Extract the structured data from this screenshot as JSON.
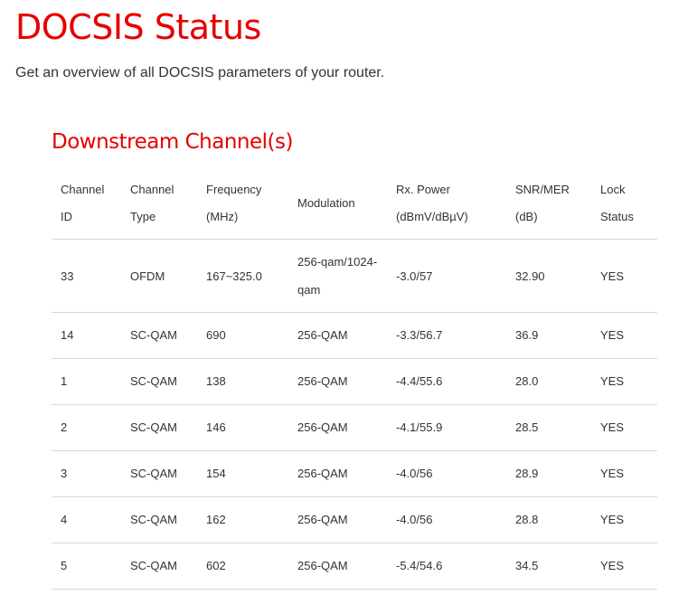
{
  "page": {
    "title": "DOCSIS Status",
    "subtitle": "Get an overview of all DOCSIS parameters of your router."
  },
  "downstream": {
    "title": "Downstream Channel(s)",
    "columns": [
      {
        "line1": "Channel",
        "line2": "ID"
      },
      {
        "line1": "Channel",
        "line2": "Type"
      },
      {
        "line1": "Frequency",
        "line2": "(MHz)"
      },
      {
        "line1": "Modulation",
        "line2": ""
      },
      {
        "line1": "Rx. Power",
        "line2": "(dBmV/dBµV)"
      },
      {
        "line1": "SNR/MER",
        "line2": "(dB)"
      },
      {
        "line1": "Lock",
        "line2": "Status"
      }
    ],
    "rows": [
      {
        "channel_id": "33",
        "channel_type": "OFDM",
        "frequency": "167~325.0",
        "modulation": "256-qam/1024-qam",
        "rx_power": "-3.0/57",
        "snr_mer": "32.90",
        "lock_status": "YES"
      },
      {
        "channel_id": "14",
        "channel_type": "SC-QAM",
        "frequency": "690",
        "modulation": "256-QAM",
        "rx_power": "-3.3/56.7",
        "snr_mer": "36.9",
        "lock_status": "YES"
      },
      {
        "channel_id": "1",
        "channel_type": "SC-QAM",
        "frequency": "138",
        "modulation": "256-QAM",
        "rx_power": "-4.4/55.6",
        "snr_mer": "28.0",
        "lock_status": "YES"
      },
      {
        "channel_id": "2",
        "channel_type": "SC-QAM",
        "frequency": "146",
        "modulation": "256-QAM",
        "rx_power": "-4.1/55.9",
        "snr_mer": "28.5",
        "lock_status": "YES"
      },
      {
        "channel_id": "3",
        "channel_type": "SC-QAM",
        "frequency": "154",
        "modulation": "256-QAM",
        "rx_power": "-4.0/56",
        "snr_mer": "28.9",
        "lock_status": "YES"
      },
      {
        "channel_id": "4",
        "channel_type": "SC-QAM",
        "frequency": "162",
        "modulation": "256-QAM",
        "rx_power": "-4.0/56",
        "snr_mer": "28.8",
        "lock_status": "YES"
      },
      {
        "channel_id": "5",
        "channel_type": "SC-QAM",
        "frequency": "602",
        "modulation": "256-QAM",
        "rx_power": "-5.4/54.6",
        "snr_mer": "34.5",
        "lock_status": "YES"
      }
    ]
  },
  "colors": {
    "brand_red": "#e60000",
    "text": "#333333",
    "divider": "#d9d9d9"
  }
}
